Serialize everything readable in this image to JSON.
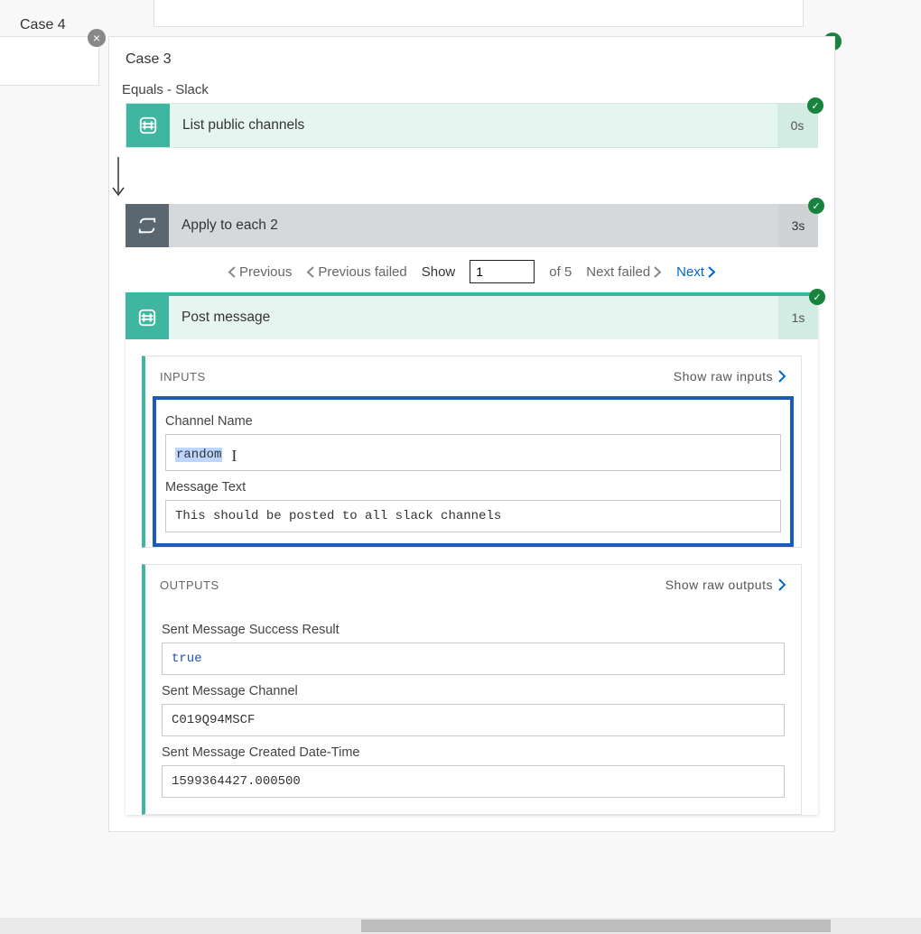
{
  "case": {
    "title": "Case 3",
    "condition": "Equals - Slack"
  },
  "case_right": {
    "title": "Case 4"
  },
  "action1": {
    "title": "List public channels",
    "duration": "0s"
  },
  "loop": {
    "title": "Apply to each 2",
    "duration": "3s"
  },
  "pager": {
    "previous": "Previous",
    "previous_failed": "Previous failed",
    "show": "Show",
    "value": "1",
    "of": "of 5",
    "next_failed": "Next failed",
    "next": "Next"
  },
  "run": {
    "title": "Post message",
    "duration": "1s"
  },
  "inputs": {
    "heading": "INPUTS",
    "raw": "Show raw inputs",
    "channel_name_label": "Channel Name",
    "channel_name_value": "random",
    "message_text_label": "Message Text",
    "message_text_value": "This should be posted to all slack channels"
  },
  "outputs": {
    "heading": "OUTPUTS",
    "raw": "Show raw outputs",
    "success_label": "Sent Message Success Result",
    "success_value": "true",
    "channel_label": "Sent Message Channel",
    "channel_value": "C019Q94MSCF",
    "created_label": "Sent Message Created Date-Time",
    "created_value": "1599364427.000500"
  }
}
